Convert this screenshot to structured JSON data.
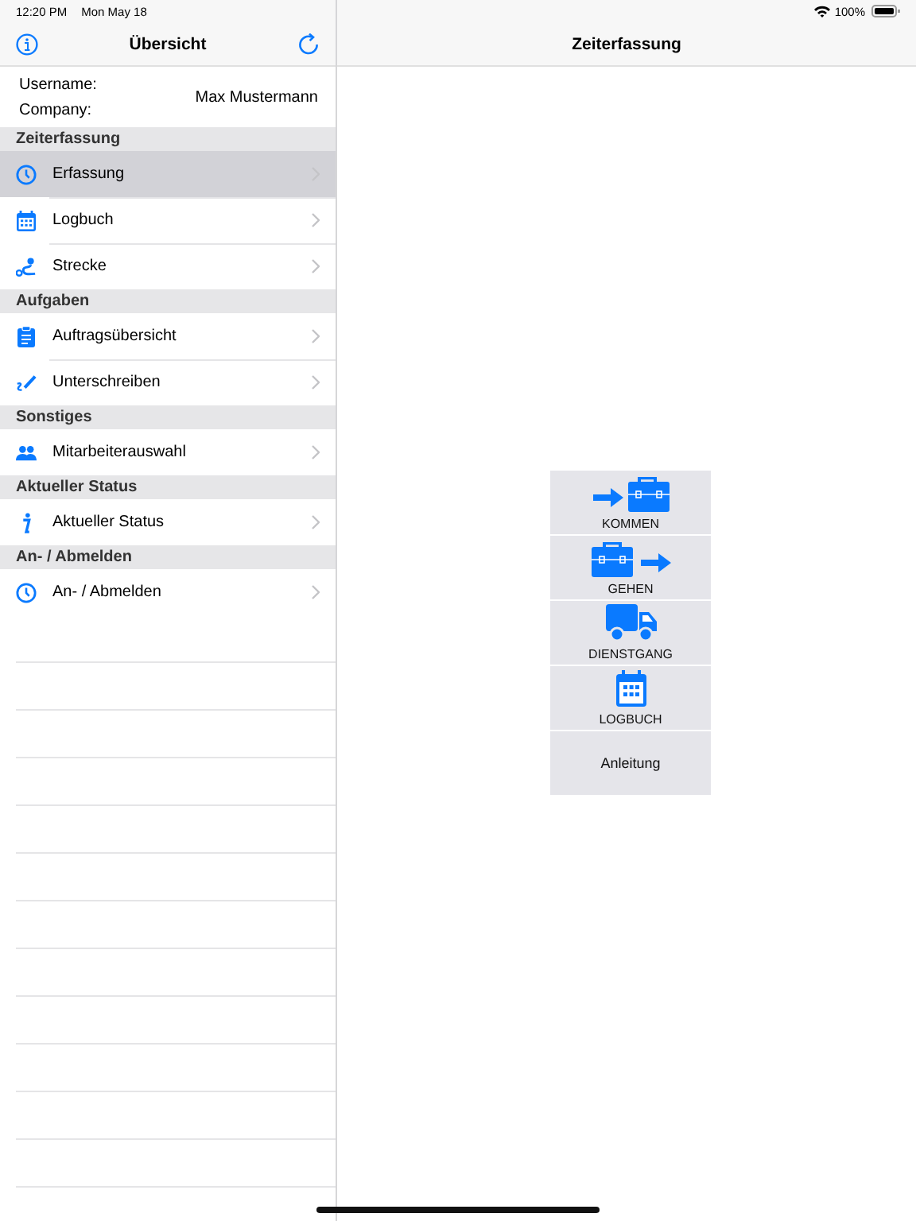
{
  "status_bar": {
    "time": "12:20 PM",
    "date": "Mon May 18",
    "battery": "100%"
  },
  "sidebar": {
    "title": "Übersicht",
    "user": {
      "username_label": "Username:",
      "company_label": "Company:",
      "username": "Max Mustermann"
    },
    "sections": [
      {
        "title": "Zeiterfassung",
        "items": [
          {
            "label": "Erfassung",
            "kind": "clock",
            "selected": true
          },
          {
            "label": "Logbuch",
            "kind": "calendar",
            "selected": false
          },
          {
            "label": "Strecke",
            "kind": "route",
            "selected": false
          }
        ]
      },
      {
        "title": "Aufgaben",
        "items": [
          {
            "label": "Auftragsübersicht",
            "kind": "clipboard",
            "selected": false
          },
          {
            "label": "Unterschreiben",
            "kind": "sign",
            "selected": false
          }
        ]
      },
      {
        "title": "Sonstiges",
        "items": [
          {
            "label": "Mitarbeiterauswahl",
            "kind": "people",
            "selected": false
          }
        ]
      },
      {
        "title": "Aktueller Status",
        "items": [
          {
            "label": "Aktueller Status",
            "kind": "info",
            "selected": false
          }
        ]
      },
      {
        "title": "An- / Abmelden",
        "items": [
          {
            "label": "An- / Abmelden",
            "kind": "clock",
            "selected": false
          }
        ]
      }
    ]
  },
  "detail": {
    "title": "Zeiterfassung",
    "buttons": [
      {
        "label": "KOMMEN",
        "kind": "in"
      },
      {
        "label": "GEHEN",
        "kind": "out"
      },
      {
        "label": "DIENSTGANG",
        "kind": "truck"
      },
      {
        "label": "LOGBUCH",
        "kind": "calendar"
      },
      {
        "label": "Anleitung",
        "kind": "text"
      }
    ]
  }
}
